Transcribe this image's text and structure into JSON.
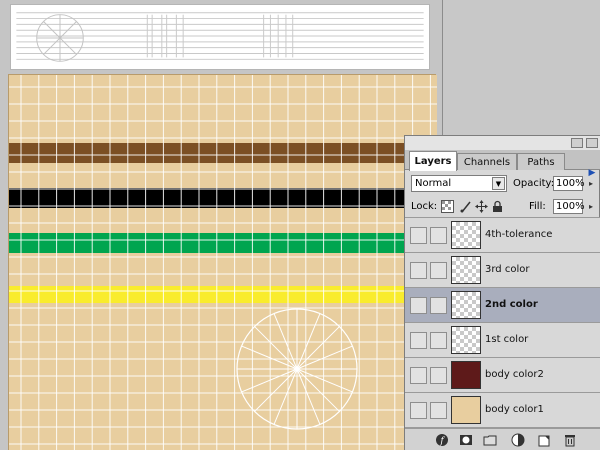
{
  "canvas": {
    "background_color": "#e8ce9f",
    "grid_color": "#ffffff",
    "stripes": [
      {
        "name": "brown-stripe",
        "color": "#7b4f24"
      },
      {
        "name": "black-stripe",
        "color": "#000000"
      },
      {
        "name": "green-stripe",
        "color": "#00a54f"
      },
      {
        "name": "yellow-stripe",
        "color": "#f9ec2d"
      }
    ]
  },
  "palette": {
    "tabs": [
      {
        "label": "Layers",
        "active": true
      },
      {
        "label": "Channels",
        "active": false
      },
      {
        "label": "Paths",
        "active": false
      }
    ],
    "menu_icon": "palette-menu-arrow-icon",
    "blend_mode": "Normal",
    "opacity_label": "Opacity:",
    "opacity_value": "100%",
    "lock_label": "Lock:",
    "fill_label": "Fill:",
    "fill_value": "100%",
    "lock_icons": [
      "lock-transparency-icon",
      "lock-image-icon",
      "lock-position-icon",
      "lock-all-icon"
    ],
    "layers": [
      {
        "name": "4th-tolerance",
        "visible": true,
        "selected": false,
        "thumb": "checker"
      },
      {
        "name": "3rd color",
        "visible": true,
        "selected": false,
        "thumb": "checker"
      },
      {
        "name": "2nd color",
        "visible": true,
        "selected": true,
        "thumb": "checker"
      },
      {
        "name": "1st color",
        "visible": true,
        "selected": false,
        "thumb": "checker"
      },
      {
        "name": "body color2",
        "visible": false,
        "selected": false,
        "thumb": "#5e1a1a"
      },
      {
        "name": "body color1",
        "visible": true,
        "selected": false,
        "thumb": "#e8ce9f"
      }
    ],
    "bottom_icons": [
      "layer-style-icon",
      "layer-mask-icon",
      "new-group-icon",
      "adjustment-layer-icon",
      "new-layer-icon",
      "trash-icon"
    ]
  }
}
